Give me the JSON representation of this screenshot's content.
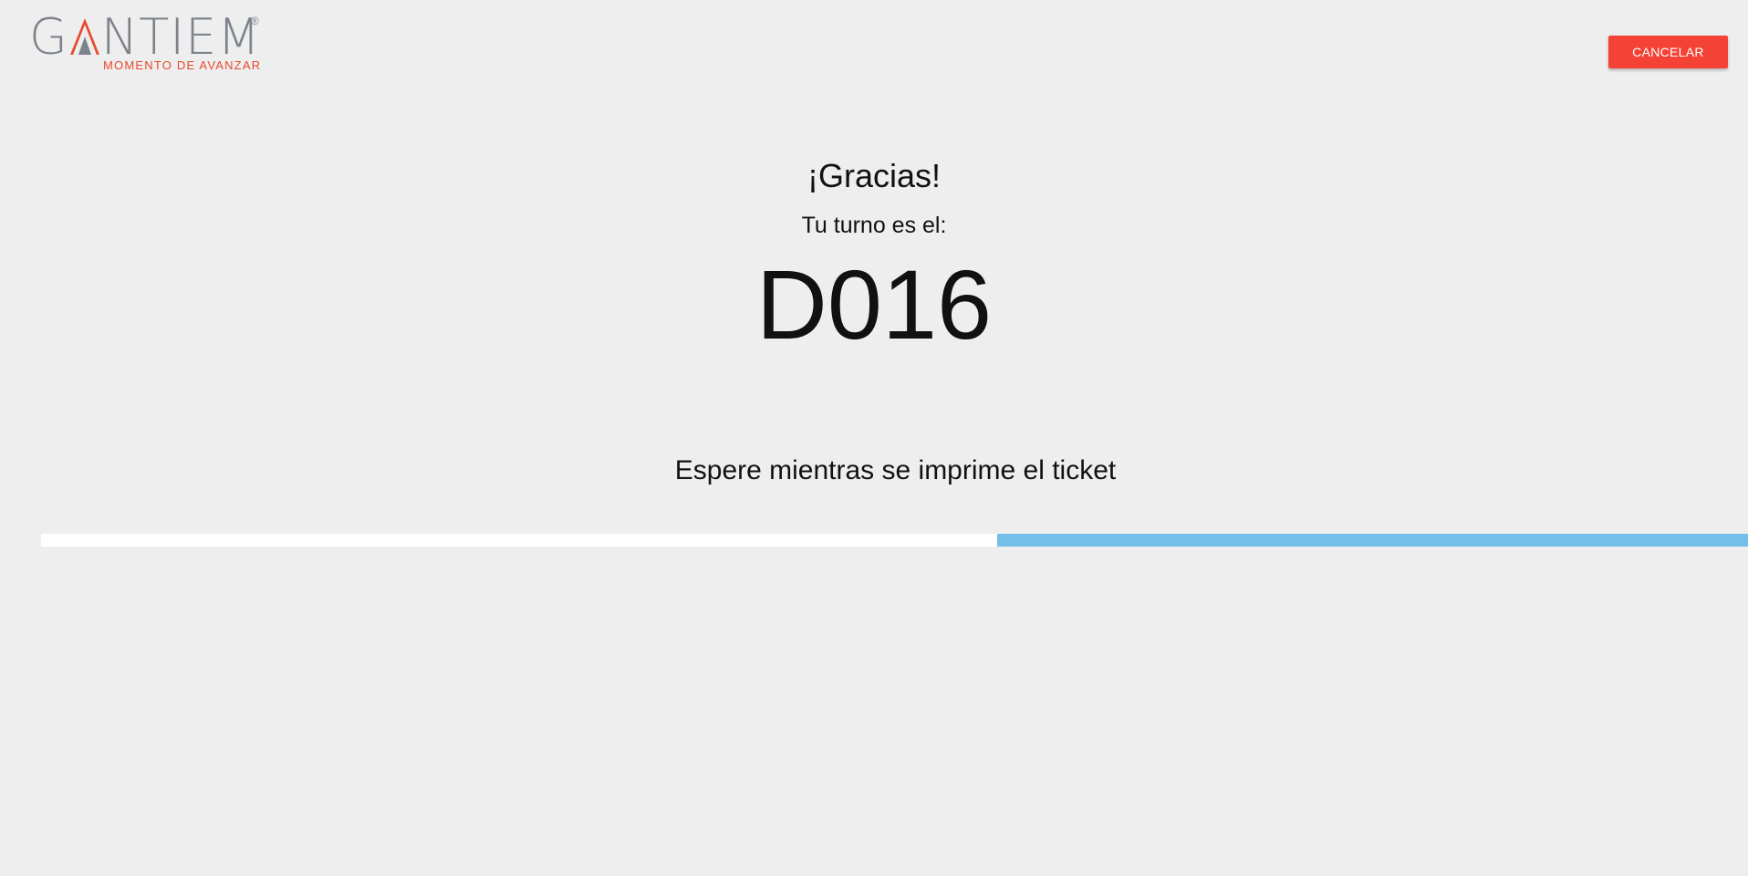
{
  "logo": {
    "wordmark_before": "G",
    "wordmark_after": "NTIEM",
    "registered": "®",
    "tagline": "MOMENTO DE AVANZAR",
    "icon": "gantiem-a-mountain-icon"
  },
  "header": {
    "cancel_label": "CANCELAR"
  },
  "main": {
    "thanks": "¡Gracias!",
    "turn_label": "Tu turno es el:",
    "turn_number": "D016",
    "wait_message": "Espere mientras se imprime el ticket"
  },
  "progress": {
    "fraction": 0.44
  },
  "colors": {
    "background": "#eeeeee",
    "accent_red": "#f44336",
    "logo_gray": "#7d838b",
    "logo_orange": "#e8492f",
    "progress_track": "#ffffff",
    "progress_fill": "#74bfea"
  }
}
